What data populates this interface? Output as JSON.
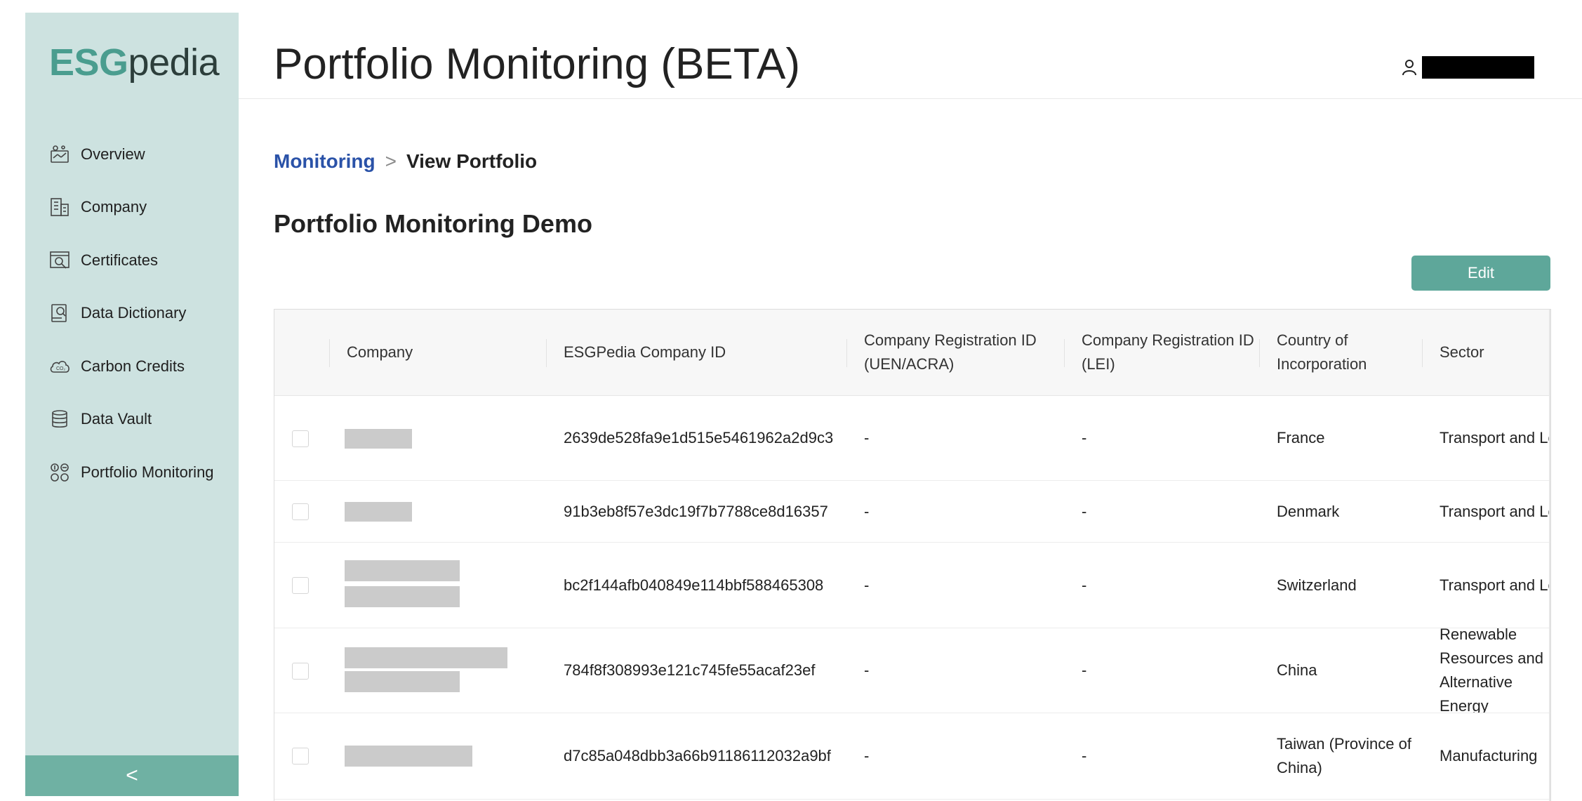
{
  "sidebar": {
    "logo": {
      "esg": "ESG",
      "pedia": "pedia"
    },
    "items": [
      {
        "label": "Overview",
        "icon": "overview-icon"
      },
      {
        "label": "Company",
        "icon": "building-icon"
      },
      {
        "label": "Certificates",
        "icon": "certificate-icon"
      },
      {
        "label": "Data Dictionary",
        "icon": "data-dictionary-icon"
      },
      {
        "label": "Carbon Credits",
        "icon": "carbon-cloud-icon"
      },
      {
        "label": "Data Vault",
        "icon": "database-icon"
      },
      {
        "label": "Portfolio Monitoring",
        "icon": "portfolio-icon"
      }
    ],
    "collapse_icon": "chevron-left-icon",
    "collapse_glyph": "<"
  },
  "header": {
    "title": "Portfolio Monitoring (BETA)",
    "user_icon": "user-icon"
  },
  "breadcrumb": {
    "link": "Monitoring",
    "separator": ">",
    "current": "View Portfolio"
  },
  "portfolio": {
    "name": "Portfolio Monitoring Demo",
    "edit_label": "Edit"
  },
  "table": {
    "columns": [
      "Company",
      "ESGPedia Company ID",
      "Company Registration ID (UEN/ACRA)",
      "Company Registration ID (LEI)",
      "Country of Incorporation",
      "Sector"
    ],
    "rows": [
      {
        "esg_id": "2639de528fa9e1d515e5461962a2d9c3",
        "uen": "-",
        "lei": "-",
        "country": "France",
        "sector": "Transport and Logistics"
      },
      {
        "esg_id": "91b3eb8f57e3dc19f7b7788ce8d16357",
        "uen": "-",
        "lei": "-",
        "country": "Denmark",
        "sector": "Transport and Logistics"
      },
      {
        "esg_id": "bc2f144afb040849e114bbf588465308",
        "uen": "-",
        "lei": "-",
        "country": "Switzerland",
        "sector": "Transport and Logistics"
      },
      {
        "esg_id": "784f8f308993e121c745fe55acaf23ef",
        "uen": "-",
        "lei": "-",
        "country": "China",
        "sector": "Renewable Resources and Alternative Energy"
      },
      {
        "esg_id": "d7c85a048dbb3a66b91186112032a9bf",
        "uen": "-",
        "lei": "-",
        "country": "Taiwan (Province of China)",
        "sector": "Manufacturing"
      }
    ]
  },
  "colors": {
    "sidebar_bg": "#cde2e0",
    "accent": "#5ea79a",
    "link": "#2a52a8"
  }
}
